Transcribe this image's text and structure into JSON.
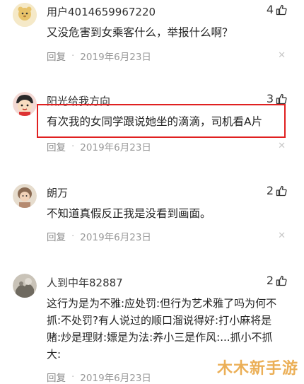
{
  "comments": [
    {
      "username": "用户4014659967220",
      "likes": "4",
      "text": "又没危害到女乘客什么，举报什么啊？",
      "reply_label": "回复",
      "date": "2019年6月23日"
    },
    {
      "username": "阳光给我方向",
      "likes": "3",
      "text": "有次我的女同学跟说她坐的滴滴，司机看A片",
      "reply_label": "回复",
      "date": "2019年6月23日"
    },
    {
      "username": "朗万",
      "likes": "2",
      "text": "不知道真假反正我是没看到画面。",
      "reply_label": "回复",
      "date": "2019年6月23日"
    },
    {
      "username": "人到中年82887",
      "likes": "2",
      "text_lines": [
        "这行为是为不雅:应处罚:但行为艺术雅了吗为何不",
        "抓:不处罚?有人说过的顺口溜说得好:打小麻将是",
        "赌:炒是理财:嫖是为法:养小三是作风:...抓小不抓",
        "大:"
      ],
      "reply_label": "回复",
      "date": "2019年6月23日"
    }
  ],
  "watermark": "木木新手游",
  "colors": {
    "highlight": "#e02020",
    "meta_gray": "#999999",
    "watermark": "#e8a23a"
  }
}
